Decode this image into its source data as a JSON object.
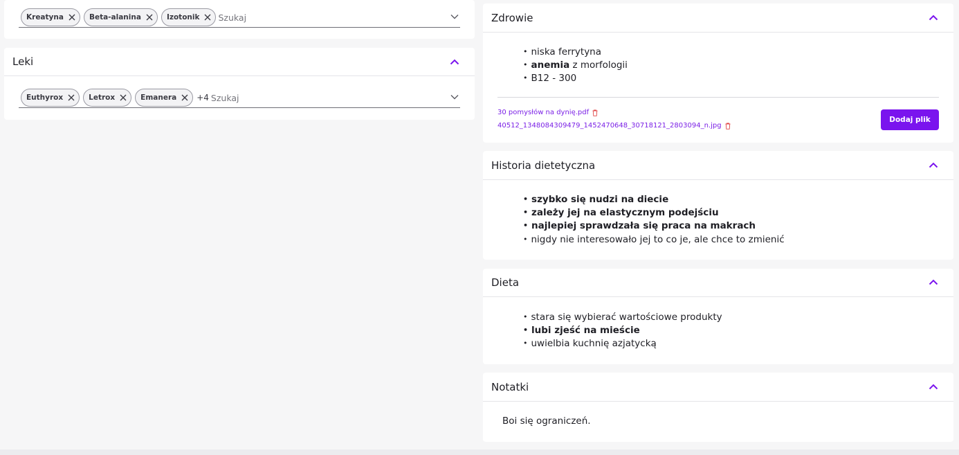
{
  "colors": {
    "accent": "#7a14ee",
    "link": "#7a1fe6",
    "success": "#22b35e",
    "trash": "#e04646"
  },
  "supplements": {
    "chips": [
      "Kreatyna",
      "Beta-alanina",
      "Izotonik"
    ],
    "search_placeholder": "Szukaj"
  },
  "leki": {
    "title": "Leki",
    "chips": [
      "Euthyrox",
      "Letrox",
      "Emanera"
    ],
    "more_count": "+4",
    "search_placeholder": "Szukaj"
  },
  "zdrowie": {
    "title": "Zdrowie",
    "items": [
      {
        "bold": "",
        "text": "niska ferrytyna"
      },
      {
        "bold": "anemia",
        "text": " z morfologii"
      },
      {
        "bold": "",
        "text": "B12 - 300"
      }
    ],
    "files": [
      "30 pomysłów na dynię.pdf",
      "40512_1348084309479_1452470648_30718121_2803094_n.jpg"
    ],
    "add_file_label": "Dodaj plik"
  },
  "historia": {
    "title": "Historia dietetyczna",
    "items": [
      {
        "style": "bold",
        "text": "szybko się nudzi na diecie"
      },
      {
        "style": "bold",
        "text": "zależy jej na elastycznym podejściu"
      },
      {
        "style": "green",
        "text": "najlepiej sprawdzała się praca na makrach"
      },
      {
        "style": "normal",
        "text": "nigdy nie interesowało jej to co je, ale chce to zmienić"
      }
    ]
  },
  "dieta": {
    "title": "Dieta",
    "items": [
      {
        "style": "normal",
        "text": "stara się wybierać wartościowe produkty"
      },
      {
        "style": "bold",
        "text": "lubi zjeść na mieście"
      },
      {
        "style": "normal",
        "text": "uwielbia kuchnię azjatycką"
      }
    ]
  },
  "notatki": {
    "title": "Notatki",
    "text": "Boi się ograniczeń."
  }
}
